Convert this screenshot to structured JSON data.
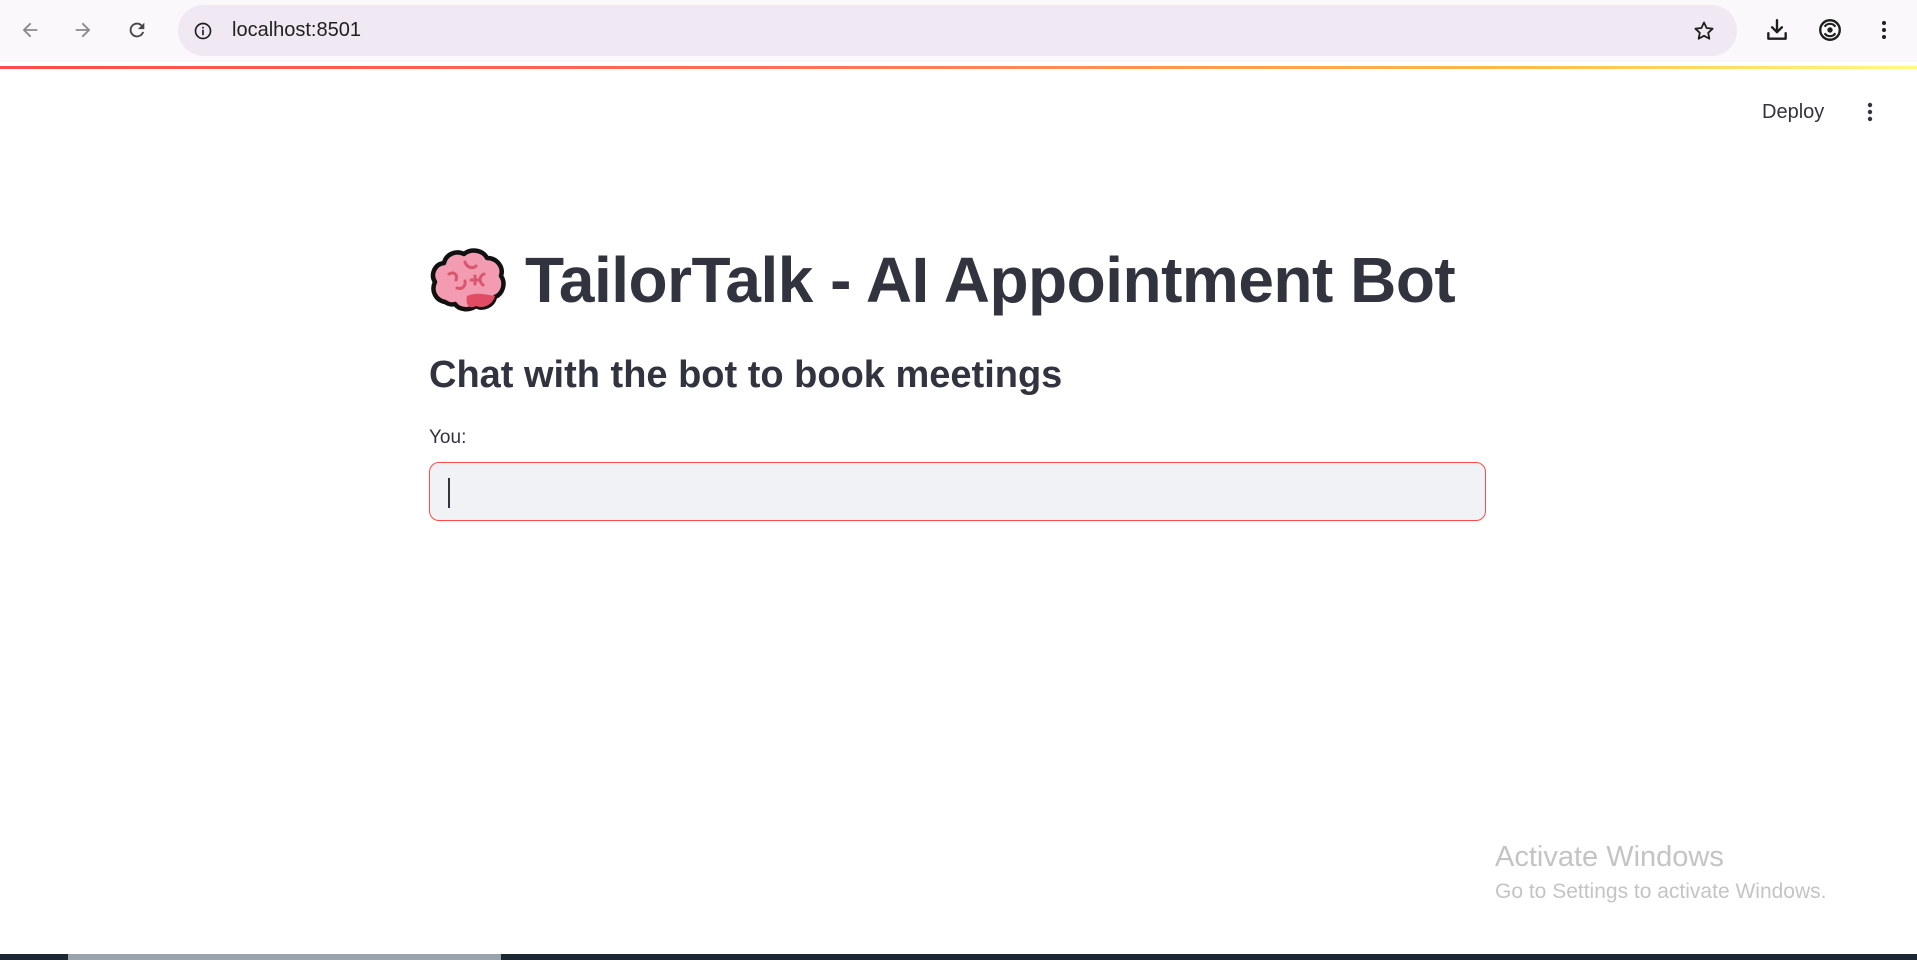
{
  "browser": {
    "url": "localhost:8501"
  },
  "app_header": {
    "deploy_label": "Deploy"
  },
  "main": {
    "title": "TailorTalk - AI Appointment Bot",
    "subtitle": "Chat with the bot to book meetings",
    "input_label": "You:",
    "input_value": "",
    "accent_color": "#ff4b4b"
  },
  "watermark": {
    "title": "Activate Windows",
    "subtitle": "Go to Settings to activate Windows."
  },
  "icons": [
    "back-arrow-icon",
    "forward-arrow-icon",
    "reload-icon",
    "info-icon",
    "star-icon",
    "download-icon",
    "profile-icon",
    "kebab-menu-icon",
    "brain-icon"
  ]
}
